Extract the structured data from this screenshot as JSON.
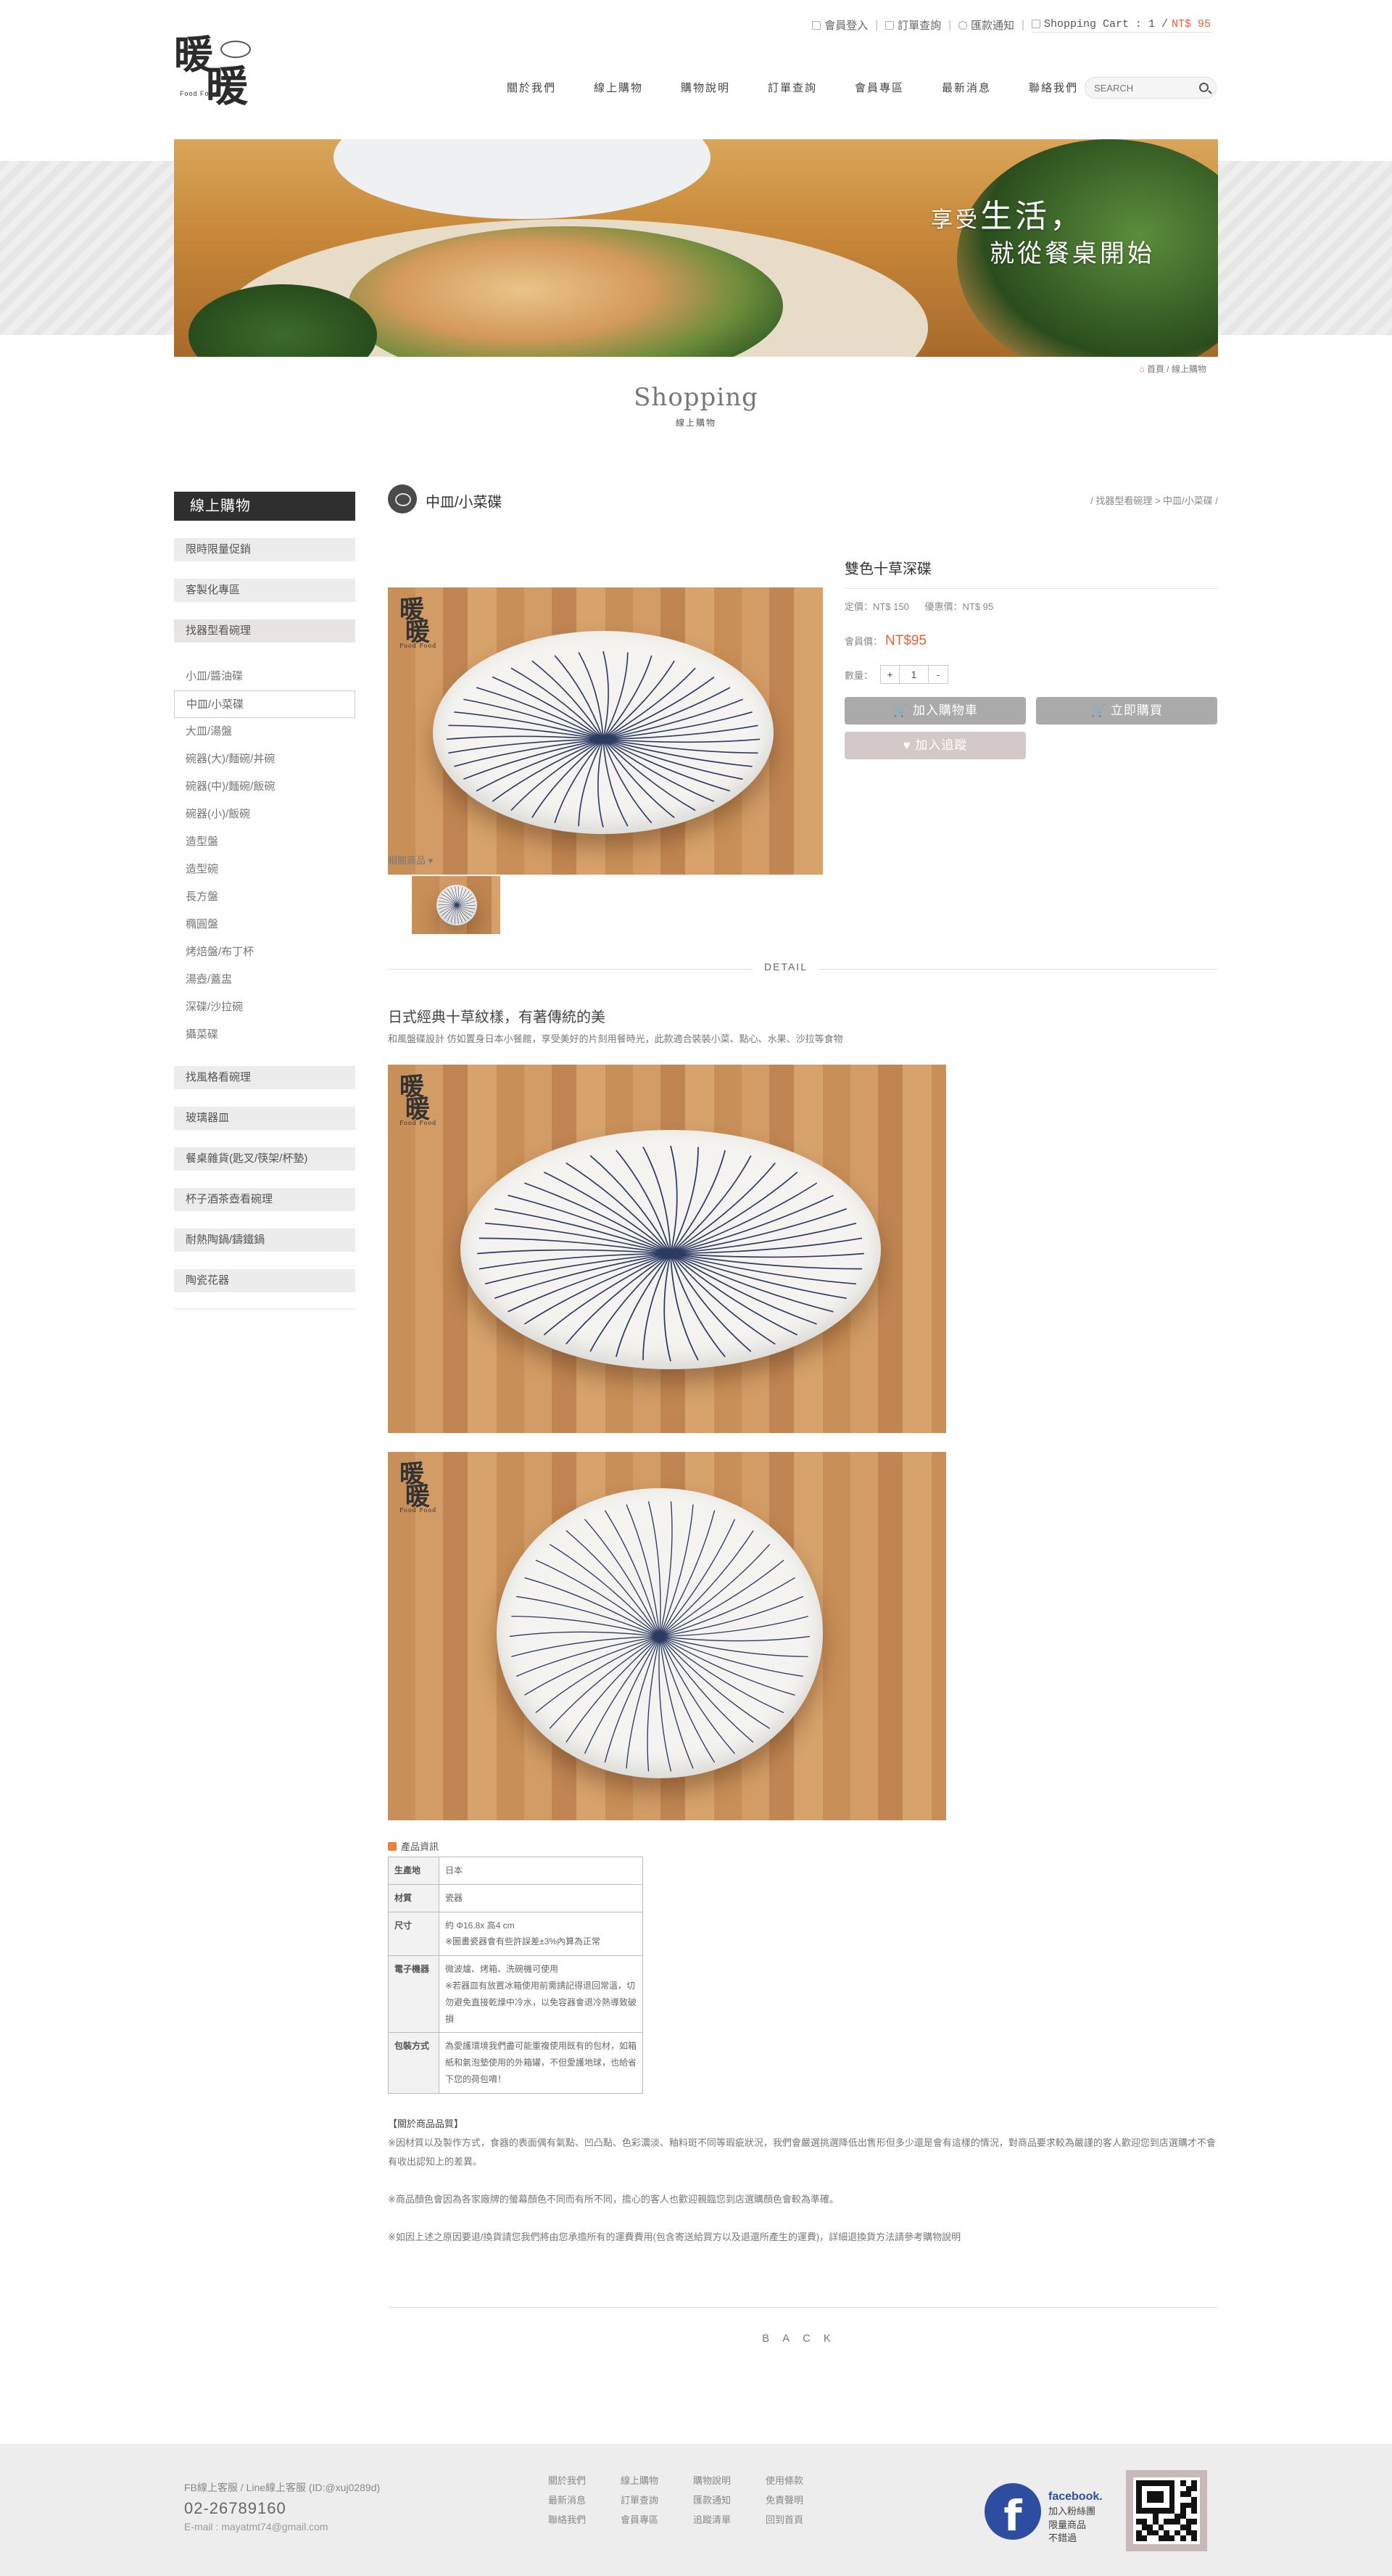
{
  "header": {
    "logo_text_1": "暖",
    "logo_text_2": "暖",
    "logo_small": "Food Food",
    "member_login": "會員登入",
    "order_query": "訂單查詢",
    "remittance": "匯款通知",
    "cart_label": "Shopping Cart : 1 /",
    "cart_total": "NT$ 95",
    "nav": [
      "關於我們",
      "線上購物",
      "購物說明",
      "訂單查詢",
      "會員專區",
      "最新消息",
      "聯絡我們"
    ],
    "search_placeholder": "SEARCH"
  },
  "banner": {
    "slogan_prefix": "享受",
    "slogan_big": "生活，",
    "slogan_line2": "就從餐桌開始"
  },
  "breadcrumb_top": {
    "home": "首頁",
    "sep": "/",
    "current": "線上購物"
  },
  "page": {
    "title": "Shopping",
    "subtitle": "線上購物"
  },
  "sidebar": {
    "heading": "線上購物",
    "top_categories": [
      "限時限量促銷",
      "客製化專區",
      "找器型看碗理"
    ],
    "sub_items": [
      "小皿/醬油碟",
      "中皿/小菜碟",
      "大皿/湯盤",
      "碗器(大)/麵碗/丼碗",
      "碗器(中)/麵碗/飯碗",
      "碗器(小)/飯碗",
      "造型盤",
      "造型碗",
      "長方盤",
      "橢圓盤",
      "烤焙盤/布丁杯",
      "湯壺/蓋盅",
      "深碟/沙拉碗",
      "攝菜碟"
    ],
    "selected_sub": "中皿/小菜碟",
    "bottom_categories": [
      "找風格看碗理",
      "玻璃器皿",
      "餐桌雜貨(匙叉/筷架/杯墊)",
      "杯子酒茶壺看碗理",
      "耐熱陶鍋/鑄鐵鍋",
      "陶瓷花器"
    ]
  },
  "main": {
    "category": "中皿/小菜碟",
    "category_crumb": "/ 找器型看碗理 > 中皿/小菜碟 /",
    "product": {
      "name": "雙色十草深碟",
      "list_price": "定價：NT$ 150",
      "sale_price": "優惠價：NT$ 95",
      "member_label": "會員價：",
      "member_price": "NT$95",
      "qty_label": "數量：",
      "qty_plus": "+",
      "qty_value": "1",
      "qty_minus": "-",
      "add_cart": "加入購物車",
      "buy_now": "立即購買",
      "add_fav": "加入追蹤"
    },
    "related_label": "相關商品",
    "detail_label": "DETAIL",
    "desc_title": "日式經典十草紋樣，有著傳統的美",
    "desc_text": "和風盤碟設計 仿如置身日本小餐館，享受美好的片刻用餐時光，此款適合裝裝小菜、點心、水果、沙拉等食物",
    "spec_title": "產品資訊",
    "spec": [
      {
        "k": "生產地",
        "v": [
          "日本"
        ]
      },
      {
        "k": "材質",
        "v": [
          "瓷器"
        ]
      },
      {
        "k": "尺寸",
        "v": [
          "約 Φ16.8x 高4 cm",
          "※圖畫瓷器會有些許誤差±3%內算為正常"
        ]
      },
      {
        "k": "電子機器",
        "v": [
          "微波爐、烤箱、洗碗機可使用",
          "※若器皿有放置冰箱使用前需請記得退回常溫，切勿避免直接乾燥中冷水，以免容器會退冷熱導致破損"
        ]
      },
      {
        "k": "包裝方式",
        "v": [
          "為愛護環境我們盡可能重複使用既有的包材，如箱紙和氣泡墊使用的外箱罐，不但愛護地球，也給省下您的荷包唷！"
        ]
      }
    ],
    "notes": {
      "heading": "【關於商品品質】",
      "p1": "※因材質以及製作方式，食器的表面偶有氣點、凹凸點、色彩濃淡、釉料斑不同等瑕疵狀況，我們會嚴選挑選降低出售形但多少還是會有這樣的情況，對商品要求較為嚴謹的客人歡迎您到店選購才不會有收出認知上的差異。",
      "p2": "※商品顏色會因為各家廠牌的螢幕顏色不同而有所不同，擔心的客人也歡迎親臨您到店選購顏色會較為準確。",
      "p3": "※如因上述之原因要退/換貨請您我們將由您承擔所有的運費費用(包含寄送給買方以及退還所產生的運費)，詳細退換貨方法請參考購物說明"
    },
    "back": "BACK"
  },
  "footer": {
    "line_info": "FB線上客服 / Line線上客服 (ID:@xuj0289d)",
    "phone": "02-26789160",
    "email": "E-mail : mayatmt74@gmail.com",
    "links": [
      "關於我們",
      "線上購物",
      "購物說明",
      "使用條款",
      "最新消息",
      "訂單查詢",
      "匯款通知",
      "免責聲明",
      "聯絡我們",
      "會員專區",
      "追蹤清單",
      "回到首頁"
    ],
    "fb_title": "facebook.",
    "fb_line1": "加入粉絲團",
    "fb_line2": "限量商品",
    "fb_line3": "不錯過"
  },
  "colors": {
    "accent": "#e8603c",
    "sidebar_head": "#2f2f2f",
    "button_gray": "#aaaaaa",
    "footer_bg": "#ededed",
    "fb_blue": "#2d4ea0"
  }
}
